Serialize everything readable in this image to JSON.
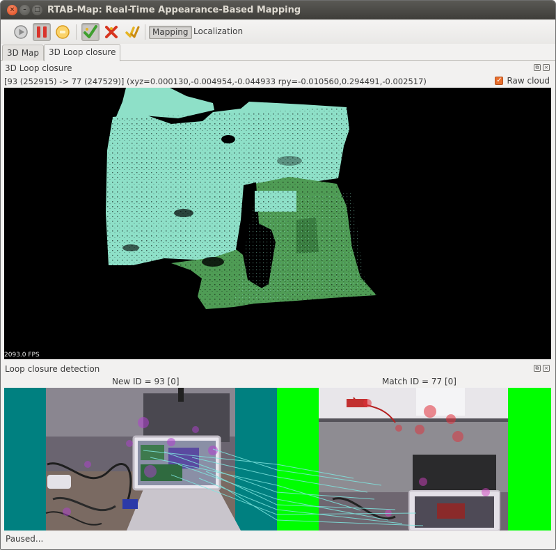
{
  "window": {
    "title": "RTAB-Map: Real-Time Appearance-Based Mapping",
    "controls": [
      "close-icon",
      "minimize-icon",
      "maximize-icon"
    ]
  },
  "toolbar": {
    "buttons": [
      {
        "name": "play-icon",
        "color": "#8a8a8a"
      },
      {
        "name": "pause-icon",
        "color": "#d9342b",
        "pressed": true
      },
      {
        "name": "stop-icon",
        "color": "#f0b43a"
      },
      {
        "name": "detection-on-icon",
        "color": "#3f9f2f",
        "pressed": true
      },
      {
        "name": "detection-off-icon",
        "color": "#d7341e"
      },
      {
        "name": "post-processing-icon",
        "color": "#e6b423"
      }
    ],
    "mapping_label": "Mapping",
    "localization_label": "Localization"
  },
  "tabs": [
    {
      "label": "3D Map",
      "active": false
    },
    {
      "label": "3D Loop closure",
      "active": true
    }
  ],
  "loop_closure_view": {
    "title": "3D Loop closure",
    "info": "[93 (252915) -> 77 (247529)]   (xyz=0.000130,-0.004954,-0.044933 rpy=-0.010560,0.294491,-0.002517)",
    "raw_cloud_label": "Raw  cloud",
    "raw_cloud_checked": true,
    "fps": "2093.0 FPS",
    "cloud_colors": {
      "cloud_a": "#8ee0c8",
      "cloud_b": "#4f9c55"
    }
  },
  "detection": {
    "title": "Loop closure detection",
    "new_id_label": "New ID = 93 [0]",
    "match_id_label": "Match ID = 77 [0]",
    "new_bg": "#008080",
    "match_bg": "#00ff00"
  },
  "status": "Paused..."
}
